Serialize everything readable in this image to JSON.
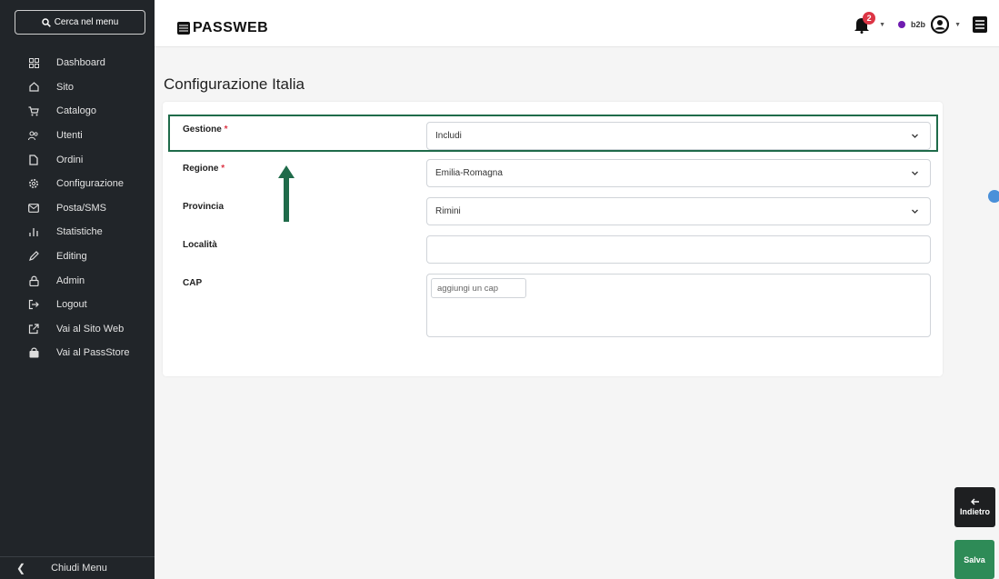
{
  "sidebar": {
    "search_label": "Cerca nel menu",
    "items": [
      {
        "label": "Dashboard",
        "icon": "dashboard-icon"
      },
      {
        "label": "Sito",
        "icon": "home-icon"
      },
      {
        "label": "Catalogo",
        "icon": "cart-icon"
      },
      {
        "label": "Utenti",
        "icon": "users-icon"
      },
      {
        "label": "Ordini",
        "icon": "file-icon"
      },
      {
        "label": "Configurazione",
        "icon": "gear-icon"
      },
      {
        "label": "Posta/SMS",
        "icon": "mail-icon"
      },
      {
        "label": "Statistiche",
        "icon": "bar-chart-icon"
      },
      {
        "label": "Editing",
        "icon": "pencil-icon"
      },
      {
        "label": "Admin",
        "icon": "lock-icon"
      },
      {
        "label": "Logout",
        "icon": "logout-icon"
      },
      {
        "label": "Vai al Sito Web",
        "icon": "external-link-icon"
      },
      {
        "label": "Vai al PassStore",
        "icon": "bag-icon"
      }
    ],
    "close_label": "Chiudi Menu"
  },
  "header": {
    "logo": "PASSWEB",
    "notification_count": "2",
    "user_role": "b2b"
  },
  "page": {
    "title": "Configurazione Italia"
  },
  "form": {
    "gestione": {
      "label": "Gestione",
      "required": "*",
      "value": "Includi"
    },
    "regione": {
      "label": "Regione",
      "required": "*",
      "value": "Emilia-Romagna"
    },
    "provincia": {
      "label": "Provincia",
      "value": "Rimini"
    },
    "localita": {
      "label": "Località",
      "value": ""
    },
    "cap": {
      "label": "CAP",
      "placeholder": "aggiungi un cap"
    }
  },
  "actions": {
    "back_label": "Indietro",
    "save_label": "Salva"
  },
  "colors": {
    "sidebar_bg": "#212529",
    "highlight": "#1f6b4a",
    "save_button": "#2e8b57",
    "badge": "#dc3545"
  }
}
